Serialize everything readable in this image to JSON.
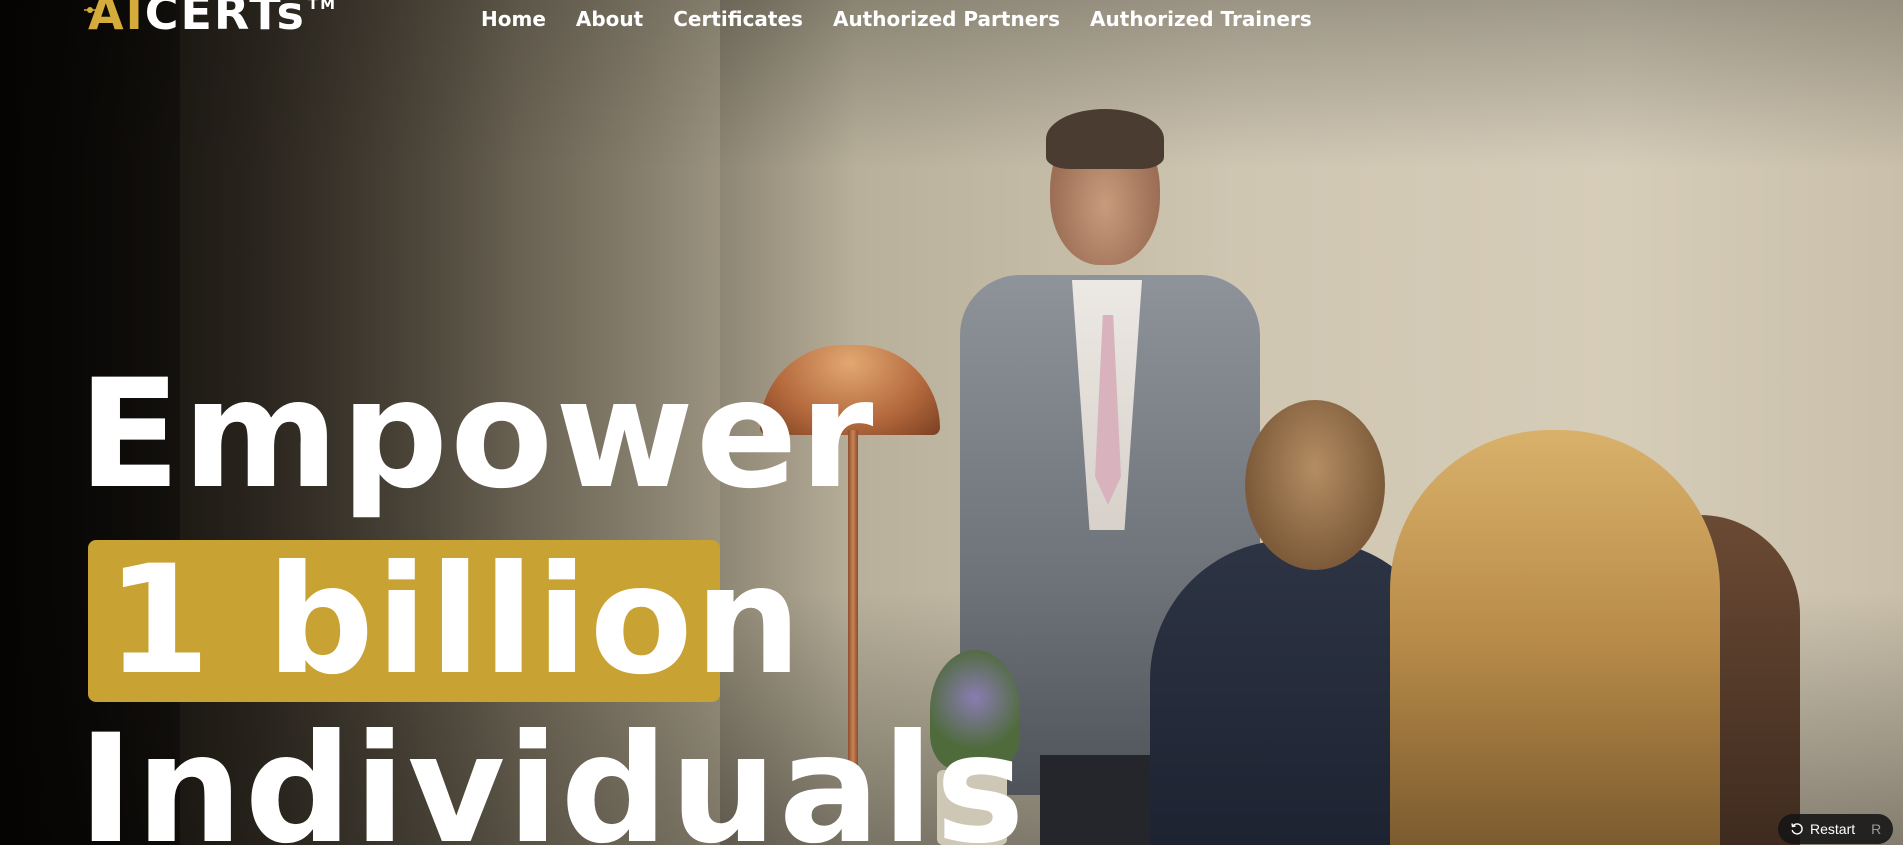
{
  "brand": {
    "logo_part1": "AI",
    "logo_part2": "CERTs",
    "logo_tm": "TM",
    "accent_color": "#d5ab3b"
  },
  "nav": {
    "items": [
      {
        "label": "Home"
      },
      {
        "label": "About"
      },
      {
        "label": "Certificates"
      },
      {
        "label": "Authorized Partners"
      },
      {
        "label": "Authorized Trainers"
      }
    ]
  },
  "hero": {
    "line1": "Empower",
    "line2": "1 billion",
    "line3": "Individuals",
    "highlight_color": "#c9a234"
  },
  "restart_control": {
    "label": "Restart",
    "shortcut": "R",
    "icon": "restart-icon"
  }
}
